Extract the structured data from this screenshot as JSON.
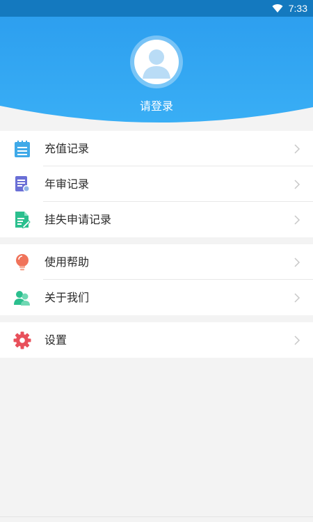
{
  "status_bar": {
    "time": "7:33",
    "wifi_icon": "wifi-icon"
  },
  "profile": {
    "login_label": "请登录",
    "avatar_icon": "avatar-icon"
  },
  "menu_groups": [
    {
      "items": [
        {
          "label": "充值记录",
          "icon": "clipboard-icon",
          "color": "#3fa9e8"
        },
        {
          "label": "年审记录",
          "icon": "document-stamp-icon",
          "color": "#6a6fd6"
        },
        {
          "label": "挂失申请记录",
          "icon": "document-edit-icon",
          "color": "#2bbf8e"
        }
      ]
    },
    {
      "items": [
        {
          "label": "使用帮助",
          "icon": "lightbulb-icon",
          "color": "#f0735a"
        },
        {
          "label": "关于我们",
          "icon": "people-icon",
          "color": "#2bbf8e"
        }
      ]
    },
    {
      "items": [
        {
          "label": "设置",
          "icon": "gear-icon",
          "color": "#e8505b"
        }
      ]
    }
  ],
  "colors": {
    "header_blue": "#2d9fef",
    "status_bar": "#1479bf",
    "background": "#f3f3f3"
  }
}
